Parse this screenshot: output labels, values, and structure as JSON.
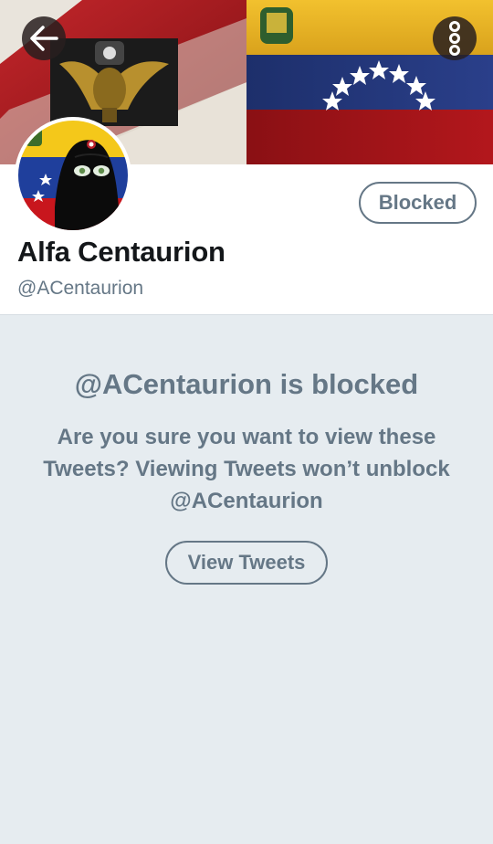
{
  "header": {
    "back_icon": "arrow-left-icon",
    "more_icon": "vertical-dots-icon"
  },
  "profile": {
    "display_name": "Alfa Centaurion",
    "handle": "@ACentaurion",
    "blocked_label": "Blocked"
  },
  "notice": {
    "title": "@ACentaurion is blocked",
    "body": "Are you sure you want to view these Tweets? Viewing Tweets won’t unblock @ACentaurion",
    "view_label": "View Tweets"
  },
  "colors": {
    "muted": "#657786",
    "background": "#e6ecf0",
    "text": "#14171a"
  }
}
